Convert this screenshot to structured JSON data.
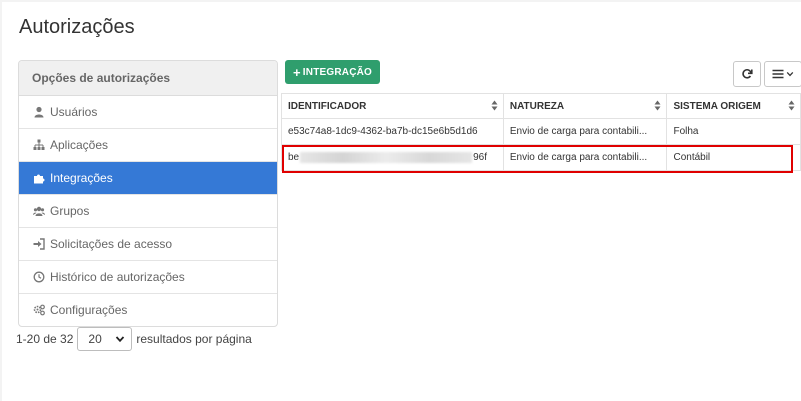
{
  "page": {
    "title": "Autorizações"
  },
  "sidebar": {
    "header": "Opções de autorizações",
    "items": [
      {
        "label": "Usuários",
        "icon": "user-icon"
      },
      {
        "label": "Aplicações",
        "icon": "sitemap-icon"
      },
      {
        "label": "Integrações",
        "icon": "puzzle-icon",
        "active": true
      },
      {
        "label": "Grupos",
        "icon": "users-icon"
      },
      {
        "label": "Solicitações de acesso",
        "icon": "sign-in-icon"
      },
      {
        "label": "Histórico de autorizações",
        "icon": "history-icon"
      },
      {
        "label": "Configurações",
        "icon": "gears-icon"
      }
    ]
  },
  "pagination": {
    "range": "1-20 de 32",
    "page_size": "20",
    "suffix": "resultados por página"
  },
  "toolbar": {
    "add_label": "INTEGRAÇÃO",
    "add_icon": "plus-icon",
    "refresh_icon": "refresh-icon",
    "columns_icon": "list-icon"
  },
  "table": {
    "headers": [
      "IDENTIFICADOR",
      "NATUREZA",
      "SISTEMA ORIGEM"
    ],
    "rows": [
      {
        "id": "e53c74a8-1dc9-4362-ba7b-dc15e6b5d1d6",
        "natureza": "Envio de carga para contabili...",
        "sistema": "Folha"
      },
      {
        "id_start": "be",
        "id_end": "96f",
        "natureza": "Envio de carga para contabili...",
        "sistema": "Contábil"
      }
    ]
  },
  "colors": {
    "accent": "#3579d6",
    "add_button": "#2f9e6d",
    "highlight": "#e00000"
  }
}
